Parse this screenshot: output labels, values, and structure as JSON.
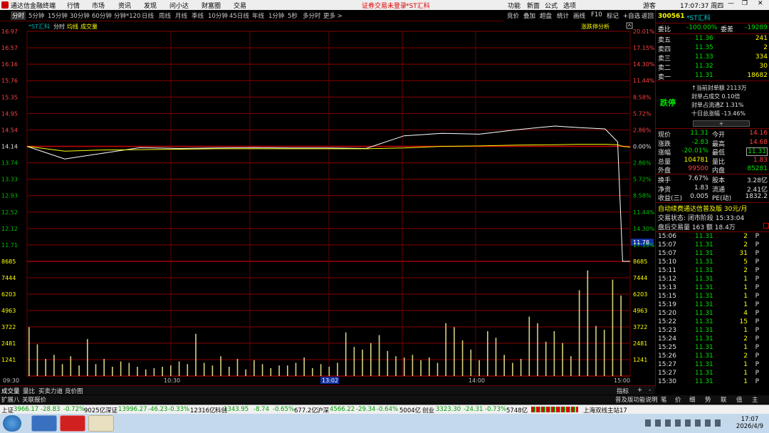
{
  "titlebar": {
    "app_name": "通达信金融终端",
    "menus": [
      "行情",
      "市场",
      "资讯",
      "发现",
      "问小达",
      "财富圈",
      "交易"
    ],
    "login_notice": "证券交易未登录",
    "stock_title": "*ST汇科",
    "right_menus": [
      "功能",
      "新面",
      "公式",
      "选项"
    ],
    "time": "17:07:37 周四",
    "guest": "游客"
  },
  "period_tabs": [
    "分时",
    "5分钟",
    "15分钟",
    "30分钟",
    "60分钟",
    "分钟*120",
    "日线",
    "周线",
    "月线",
    "季线",
    "10分钟",
    "45日线",
    "年线",
    "1分钟",
    "5秒",
    "多分时",
    "更多 >"
  ],
  "right_toolbar": [
    "竞价",
    "叠加",
    "超盘",
    "统计",
    "画线",
    "F10",
    "标记",
    "+自选",
    "返回"
  ],
  "chart": {
    "legend_stock": "*ST汇科",
    "legend_items": [
      "分时",
      "均线",
      "成交量"
    ],
    "top_right_button": "涨跌停分析",
    "price_ticks_left": [
      "16.97",
      "16.57",
      "16.16",
      "15.76",
      "15.35",
      "14.95",
      "14.54",
      "14.14",
      "13.74",
      "13.33",
      "12.93",
      "12.52",
      "12.12",
      "11.71"
    ],
    "pct_ticks_right": [
      "20.01%",
      "17.15%",
      "14.30%",
      "11.44%",
      "8.58%",
      "5.72%",
      "2.86%",
      "0.00%",
      "2.86%",
      "5.72%",
      "8.58%",
      "11.44%",
      "14.30%",
      "17.15%"
    ],
    "current_price_tag": "11.78",
    "volume_ticks": [
      "8685",
      "7444",
      "6203",
      "4963",
      "3722",
      "2481",
      "1241"
    ],
    "time_labels": [
      "09:30",
      "10:30",
      "13:02",
      "14:00",
      "15:00"
    ]
  },
  "chart_data": {
    "type": "line",
    "title": "",
    "xlabel": "",
    "ylabel": "",
    "ylim": [
      11.31,
      16.97
    ],
    "prev_close": 14.14,
    "x": [
      "09:30",
      "09:45",
      "10:00",
      "10:15",
      "10:30",
      "10:45",
      "11:00",
      "11:15",
      "11:30",
      "13:15",
      "13:30",
      "13:45",
      "14:00",
      "14:15",
      "14:30",
      "14:40",
      "14:50",
      "14:55",
      "14:57",
      "15:00"
    ],
    "series": [
      {
        "values": [
          14.14,
          13.83,
          13.97,
          14.11,
          14.09,
          14.1,
          14.11,
          14.1,
          14.1,
          14.09,
          14.4,
          14.46,
          14.44,
          14.55,
          14.64,
          14.6,
          14.57,
          14.25,
          11.31,
          11.31
        ]
      },
      {
        "values": [
          14.14,
          14.02,
          14.05,
          14.06,
          14.07,
          14.08,
          14.08,
          14.08,
          14.08,
          14.08,
          14.1,
          14.14,
          14.15,
          14.17,
          14.18,
          14.19,
          14.19,
          14.18,
          14.14,
          14.12
        ]
      }
    ],
    "volume_ylim": [
      0,
      8685
    ],
    "volume_values": [
      3700,
      2400,
      1300,
      1600,
      900,
      1500,
      800,
      2800,
      900,
      1300,
      700,
      1100,
      1000,
      700,
      500,
      600,
      700,
      800,
      1100,
      900,
      3200,
      1000,
      800,
      1500,
      700,
      1300,
      500,
      1200,
      900,
      600,
      800,
      800,
      1000,
      1400,
      600,
      900,
      700,
      1000,
      3300,
      2200,
      2000,
      2500,
      3100,
      1900,
      1500,
      1400,
      1600,
      1200,
      1400,
      1000,
      4000,
      3700,
      2700,
      2000,
      1200,
      3400,
      2900,
      1600,
      1000,
      1300,
      4500,
      4000,
      2600,
      3400,
      2500,
      1500,
      6500,
      8000,
      3800,
      3500,
      7300,
      6100
    ]
  },
  "right_panel": {
    "code": "300561",
    "name": "*ST汇科",
    "weibi_label": "委比",
    "weibi_value": "-100.00%",
    "weicha_label": "委差",
    "weicha_value": "-19289",
    "asks": [
      {
        "label": "卖五",
        "price": "11.36",
        "vol": "241"
      },
      {
        "label": "卖四",
        "price": "11.35",
        "vol": "2"
      },
      {
        "label": "卖三",
        "price": "11.33",
        "vol": "334"
      },
      {
        "label": "卖二",
        "price": "11.32",
        "vol": "30"
      },
      {
        "label": "卖一",
        "price": "11.31",
        "vol": "18682"
      }
    ],
    "limit_status": "跌停",
    "limit_lines": [
      "↑当前封单额 2113万",
      "封单占成交 0.10倍",
      "封单占流通Z 1.31%",
      "十日总涨幅 -13.46%"
    ],
    "quote": [
      {
        "l": "现价",
        "v": "11.31",
        "l2": "今开",
        "v2": "14.16"
      },
      {
        "l": "涨跌",
        "v": "-2.83",
        "l2": "最高",
        "v2": "14.68"
      },
      {
        "l": "涨幅",
        "v": "-20.01%",
        "l2": "最低",
        "v2": "11.31"
      },
      {
        "l": "总量",
        "v": "104781",
        "l2": "量比",
        "v2": "1.83"
      },
      {
        "l": "外盘",
        "v": "99500",
        "l2": "内盘",
        "v2": "85281"
      }
    ],
    "quote2": [
      {
        "l": "换手",
        "v": "7.67%",
        "l2": "股本",
        "v2": "3.28亿"
      },
      {
        "l": "净资",
        "v": "1.83",
        "l2": "流通",
        "v2": "2.41亿"
      },
      {
        "l": "收益(三)",
        "v": "0.005",
        "l2": "PE(动)",
        "v2": "1832.2"
      }
    ],
    "promo": "自动续费通达信普及版 30元/月",
    "trade_state": "交易状态: 闭市阶段 15:33:04",
    "after_hours": "盘后交易量 163 额 18.4万",
    "ticks": [
      {
        "t": "15:06",
        "p": "11.31",
        "v": "2",
        "s": "P"
      },
      {
        "t": "15:07",
        "p": "11.31",
        "v": "2",
        "s": "P"
      },
      {
        "t": "15:07",
        "p": "11.31",
        "v": "31",
        "s": "P"
      },
      {
        "t": "15:10",
        "p": "11.31",
        "v": "5",
        "s": "P"
      },
      {
        "t": "15:11",
        "p": "11.31",
        "v": "2",
        "s": "P"
      },
      {
        "t": "15:12",
        "p": "11.31",
        "v": "1",
        "s": "P"
      },
      {
        "t": "15:13",
        "p": "11.31",
        "v": "1",
        "s": "P"
      },
      {
        "t": "15:15",
        "p": "11.31",
        "v": "1",
        "s": "P"
      },
      {
        "t": "15:19",
        "p": "11.31",
        "v": "1",
        "s": "P"
      },
      {
        "t": "15:20",
        "p": "11.31",
        "v": "4",
        "s": "P"
      },
      {
        "t": "15:22",
        "p": "11.31",
        "v": "15",
        "s": "P"
      },
      {
        "t": "15:23",
        "p": "11.31",
        "v": "1",
        "s": "P"
      },
      {
        "t": "15:24",
        "p": "11.31",
        "v": "2",
        "s": "P"
      },
      {
        "t": "15:25",
        "p": "11.31",
        "v": "1",
        "s": "P"
      },
      {
        "t": "15:26",
        "p": "11.31",
        "v": "2",
        "s": "P"
      },
      {
        "t": "15:27",
        "p": "11.31",
        "v": "1",
        "s": "P"
      },
      {
        "t": "15:27",
        "p": "11.31",
        "v": "1",
        "s": "P"
      },
      {
        "t": "15:30",
        "p": "11.31",
        "v": "1",
        "s": "P"
      }
    ]
  },
  "bottom_tabs": [
    "成交量",
    "量比",
    "买卖力道",
    "竞价图"
  ],
  "bottom_right_tabs": [
    "指标",
    "+",
    "-"
  ],
  "bottom_tabs2": [
    "扩展八",
    "关联报价"
  ],
  "bottom_tabs2_right": "普及版功能说明",
  "right_bottom_tabs": [
    "笔",
    "价",
    "细",
    "势",
    "联",
    "值",
    "主"
  ],
  "index_bar": [
    {
      "name": "上证",
      "val": "3966.17",
      "chg": "-28.83",
      "pct": "-0.72%",
      "amt": "9025亿"
    },
    {
      "name": "深证",
      "val": "13996.27",
      "chg": "-46.23",
      "pct": "-0.33%",
      "amt": "12316亿"
    },
    {
      "name": "科创",
      "val": "1343.95",
      "chg": "-8.74",
      "pct": "-0.65%",
      "amt": "677.2亿"
    },
    {
      "name": "沪深",
      "val": "4566.22",
      "chg": "-29.34",
      "pct": "-0.64%",
      "amt": "5004亿"
    },
    {
      "name": "创业",
      "val": "3323.30",
      "chg": "-24.31",
      "pct": "-0.73%",
      "amt": "5748亿"
    }
  ],
  "server_label": "上海双线主站17",
  "taskbar": {
    "time": "17:07",
    "date": "2026/4/9"
  },
  "colors": {
    "up": "#ff4040",
    "down": "#00e000",
    "price_line": "#ffffff",
    "avg_line": "#ffff00",
    "grid": "#8a0000"
  }
}
